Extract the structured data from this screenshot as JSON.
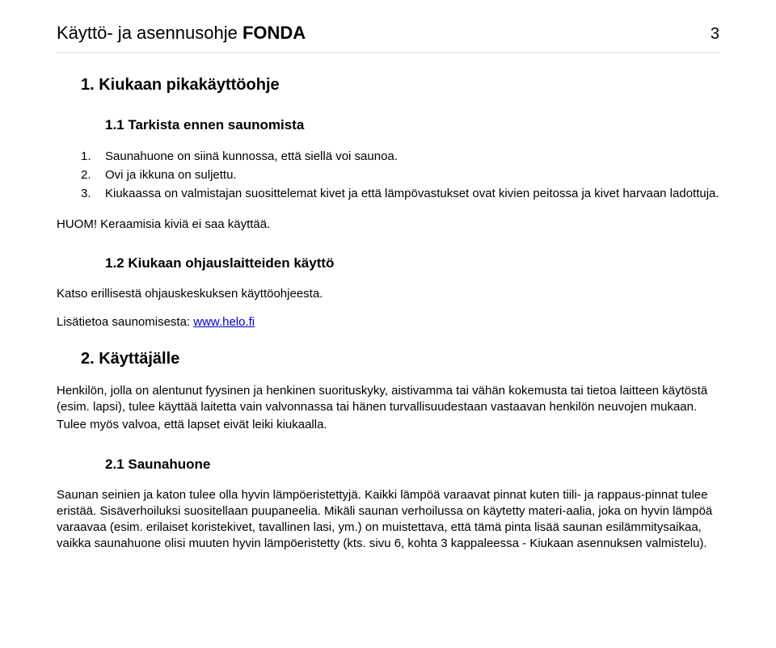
{
  "header": {
    "title_prefix": "Käyttö- ja asennusohje ",
    "title_bold": "FONDA",
    "page_number": "3"
  },
  "sections": {
    "h1_1": "1.  Kiukaan pikakäyttöohje",
    "h2_1_1": "1.1   Tarkista ennen saunomista",
    "list_1_1": [
      {
        "num": "1.",
        "text": "Saunahuone on siinä kunnossa, että siellä voi saunoa."
      },
      {
        "num": "2.",
        "text": "Ovi ja ikkuna on suljettu."
      },
      {
        "num": "3.",
        "text": "Kiukaassa on valmistajan suosittelemat kivet ja että lämpövastukset ovat kivien peitossa ja kivet harvaan ladottuja."
      }
    ],
    "note_1_1": "HUOM! Keraamisia kiviä ei saa käyttää.",
    "h2_1_2": "1.2   Kiukaan ohjauslaitteiden käyttö",
    "para_1_2_a": "Katso erillisestä ohjauskeskuksen käyttöohjeesta.",
    "para_1_2_link_prefix": "Lisätietoa saunomisesta: ",
    "para_1_2_link_text": "www.helo.fi",
    "h1_2": "2.  Käyttäjälle",
    "para_2_a": "Henkilön, jolla on alentunut fyysinen ja henkinen suorituskyky, aistivamma tai vähän kokemusta tai tietoa laitteen käytöstä (esim. lapsi), tulee käyttää laitetta vain valvonnassa tai hänen turvallisuudestaan vastaavan henkilön neuvojen mukaan.",
    "para_2_b": "Tulee myös valvoa, että lapset eivät leiki kiukaalla.",
    "h2_2_1": "2.1   Saunahuone",
    "para_2_1": "Saunan seinien ja katon tulee olla hyvin lämpöeristettyjä. Kaikki lämpöä varaavat pinnat kuten tiili- ja rappaus-pinnat tulee eristää. Sisäverhoiluksi suositellaan puupaneelia.  Mikäli saunan verhoilussa on käytetty materi-aalia, joka on hyvin lämpöä varaavaa (esim. erilaiset koristekivet, tavallinen lasi, ym.) on muistettava, että tämä pinta lisää saunan esilämmitysaikaa, vaikka saunahuone olisi muuten hyvin lämpöeristetty (kts. sivu 6, kohta 3 kappaleessa - Kiukaan asennuksen valmistelu)."
  }
}
